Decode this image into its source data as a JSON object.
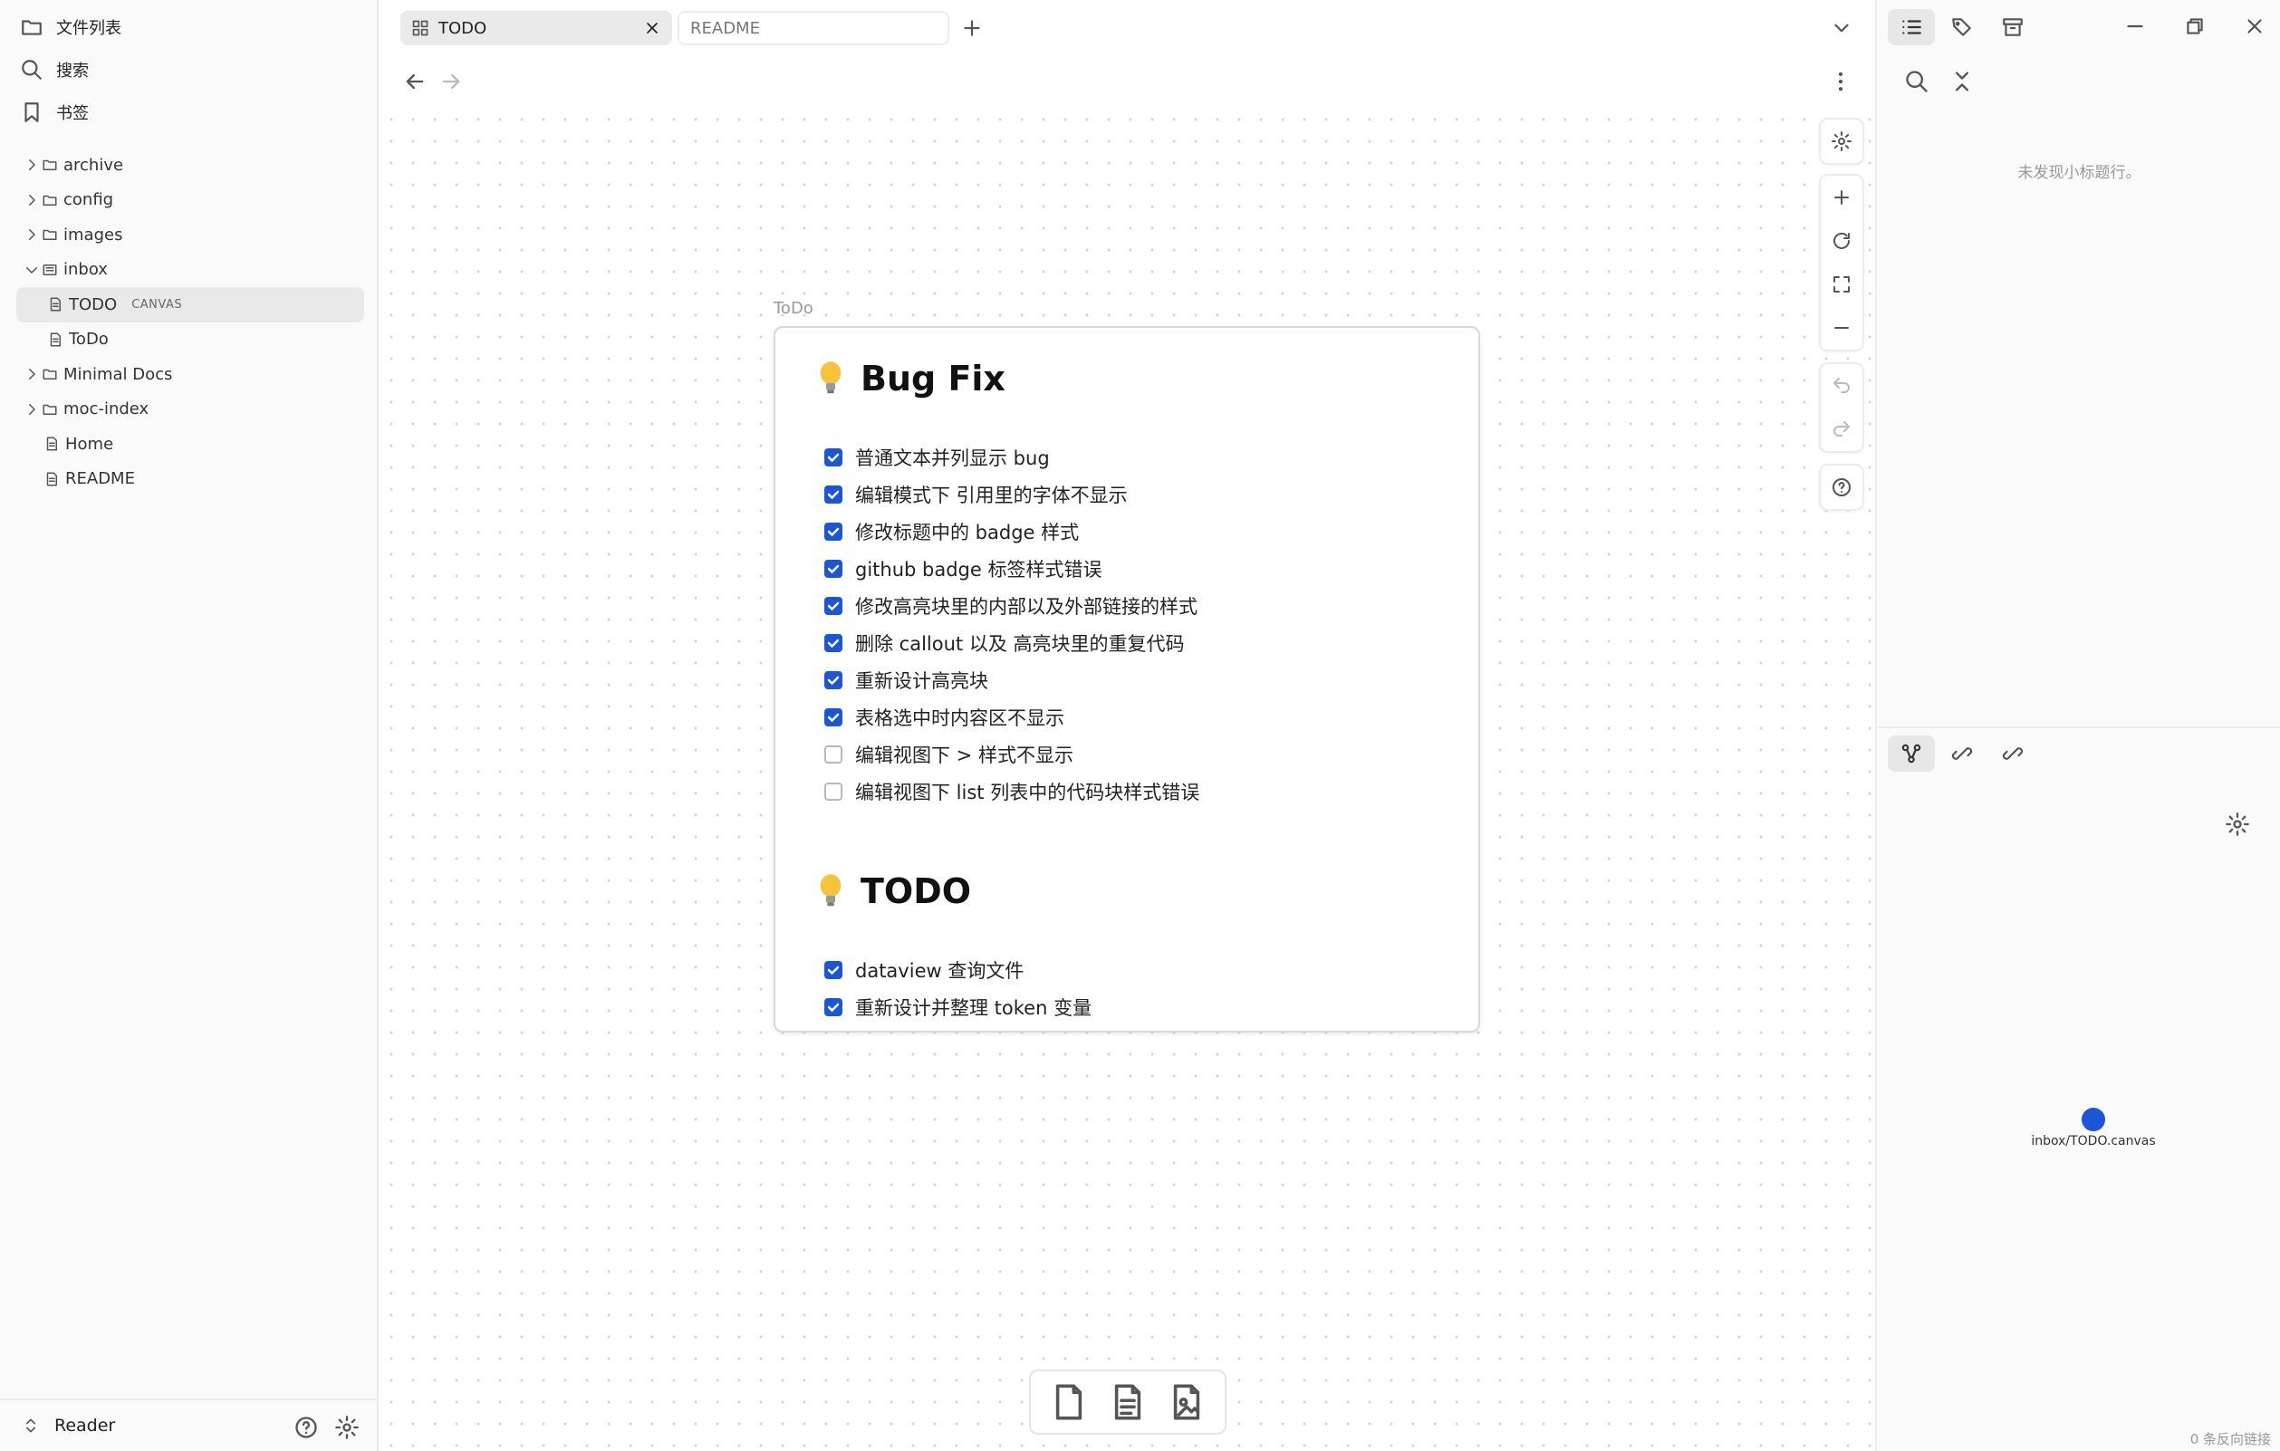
{
  "sidebar": {
    "top": {
      "files_label": "文件列表",
      "search_label": "搜索",
      "bookmarks_label": "书签"
    },
    "tree": [
      {
        "label": "archive",
        "type": "folder",
        "expanded": false
      },
      {
        "label": "config",
        "type": "folder",
        "expanded": false
      },
      {
        "label": "images",
        "type": "folder",
        "expanded": false
      },
      {
        "label": "inbox",
        "type": "folder",
        "expanded": true
      },
      {
        "label": "TODO",
        "type": "canvas",
        "tag": "CANVAS",
        "active": true
      },
      {
        "label": "ToDo",
        "type": "file"
      },
      {
        "label": "Minimal Docs",
        "type": "folder",
        "expanded": false
      },
      {
        "label": "moc-index",
        "type": "folder",
        "expanded": false
      },
      {
        "label": "Home",
        "type": "file"
      },
      {
        "label": "README",
        "type": "file"
      }
    ],
    "vault_name": "Reader"
  },
  "tabs": [
    {
      "label": "TODO",
      "active": true
    },
    {
      "label": "README",
      "active": false
    }
  ],
  "canvas": {
    "card_label": "ToDo",
    "sections": [
      {
        "heading": "Bug Fix",
        "tasks": [
          {
            "text": "普通文本并列显示 bug",
            "done": true
          },
          {
            "text": "编辑模式下 引用里的字体不显示",
            "done": true
          },
          {
            "text": "修改标题中的 badge 样式",
            "done": true
          },
          {
            "text": "github badge 标签样式错误",
            "done": true
          },
          {
            "text": "修改高亮块里的内部以及外部链接的样式",
            "done": true
          },
          {
            "text": "删除 callout 以及 高亮块里的重复代码",
            "done": true
          },
          {
            "text": "重新设计高亮块",
            "done": true
          },
          {
            "text": "表格选中时内容区不显示",
            "done": true
          },
          {
            "text": "编辑视图下 > 样式不显示",
            "done": false
          },
          {
            "text": "编辑视图下 list 列表中的代码块样式错误",
            "done": false
          }
        ]
      },
      {
        "heading": "TODO",
        "tasks": [
          {
            "text": "dataview 查询文件",
            "done": true
          },
          {
            "text": "重新设计并整理 token 变量",
            "done": true
          }
        ]
      }
    ]
  },
  "rightbar": {
    "outline_empty": "未发现小标题行。",
    "graph_node_label": "inbox/TODO.canvas",
    "backlinks_count": "0 条反向链接"
  },
  "colors": {
    "accent": "#1a56d6",
    "sidebar_bg": "#fafafa",
    "active_row": "#e9e9e9"
  }
}
